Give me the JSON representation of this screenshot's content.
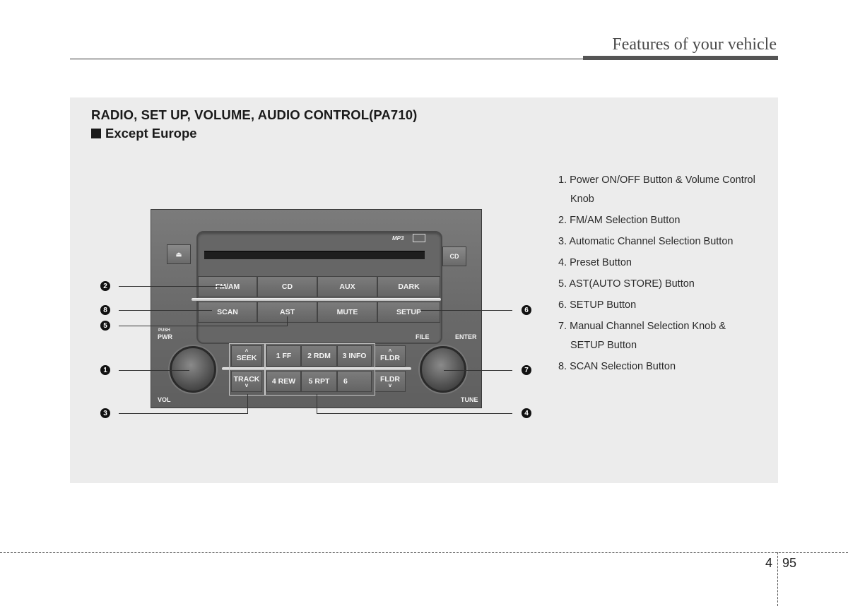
{
  "header": {
    "section_title": "Features of your vehicle"
  },
  "content": {
    "title": "RADIO, SET UP, VOLUME, AUDIO CONTROL(PA710)",
    "subtitle": "Except Europe",
    "legend": [
      {
        "text": "1. Power ON/OFF Button & Volume Control",
        "cont": "Knob"
      },
      {
        "text": "2. FM/AM Selection Button"
      },
      {
        "text": "3. Automatic Channel Selection Button"
      },
      {
        "text": "4. Preset Button"
      },
      {
        "text": "5. AST(AUTO STORE) Button"
      },
      {
        "text": "6. SETUP Button"
      },
      {
        "text": "7. Manual Channel Selection Knob &",
        "cont": "SETUP Button"
      },
      {
        "text": "8. SCAN Selection Button"
      }
    ]
  },
  "radio": {
    "eject_icon": "eject-icon",
    "eject_glyph": "⏏",
    "cd_side_label": "CD",
    "mp3_label": "MP3",
    "top_row": [
      "FM/AM",
      "CD",
      "AUX",
      "DARK"
    ],
    "second_row": [
      "SCAN",
      "AST",
      "MUTE",
      "SETUP"
    ],
    "push_label": "PUSH",
    "pwr_label": "PWR",
    "vol_label": "VOL",
    "file_label": "FILE",
    "enter_label": "ENTER",
    "tune_label": "TUNE",
    "seek_label": "SEEK",
    "track_label": "TRACK",
    "up_glyph": "^",
    "down_glyph": "v",
    "presets_top": [
      "1  FF",
      "2 RDM",
      "3 INFO"
    ],
    "presets_bottom": [
      "4 REW",
      "5 RPT",
      "6"
    ],
    "fldr_label": "FLDR"
  },
  "callouts": {
    "c1": "1",
    "c2": "2",
    "c3": "3",
    "c4": "4",
    "c5": "5",
    "c6": "6",
    "c7": "7",
    "c8": "8"
  },
  "footer": {
    "chapter": "4",
    "page": "95"
  }
}
